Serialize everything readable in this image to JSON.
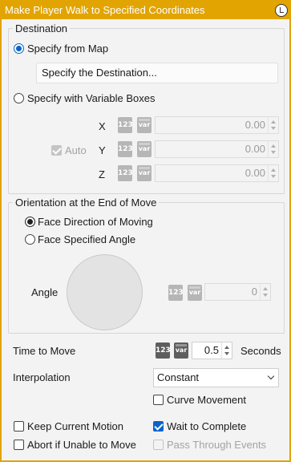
{
  "window": {
    "title": "Make Player Walk to Specified Coordinates",
    "accent": "#e2a400"
  },
  "destination": {
    "legend": "Destination",
    "from_map_label": "Specify from Map",
    "destination_button": "Specify the Destination...",
    "variable_boxes_label": "Specify with Variable Boxes",
    "auto_label": "Auto",
    "x_label": "X",
    "x_value": "0.00",
    "y_label": "Y",
    "y_value": "0.00",
    "z_label": "Z",
    "z_value": "0.00"
  },
  "orientation": {
    "legend": "Orientation at the End of Move",
    "face_moving_label": "Face Direction of Moving",
    "face_angle_label": "Face Specified Angle",
    "angle_label": "Angle",
    "angle_value": "0"
  },
  "icons": {
    "number_icon": "123",
    "variable_icon": "var"
  },
  "time": {
    "label": "Time to Move",
    "value": "0.5",
    "unit": "Seconds"
  },
  "interpolation": {
    "label": "Interpolation",
    "selected": "Constant",
    "curve_label": "Curve Movement"
  },
  "options": {
    "keep_motion_label": "Keep Current Motion",
    "wait_label": "Wait to Complete",
    "abort_label": "Abort if Unable to Move",
    "pass_through_label": "Pass Through Events"
  }
}
